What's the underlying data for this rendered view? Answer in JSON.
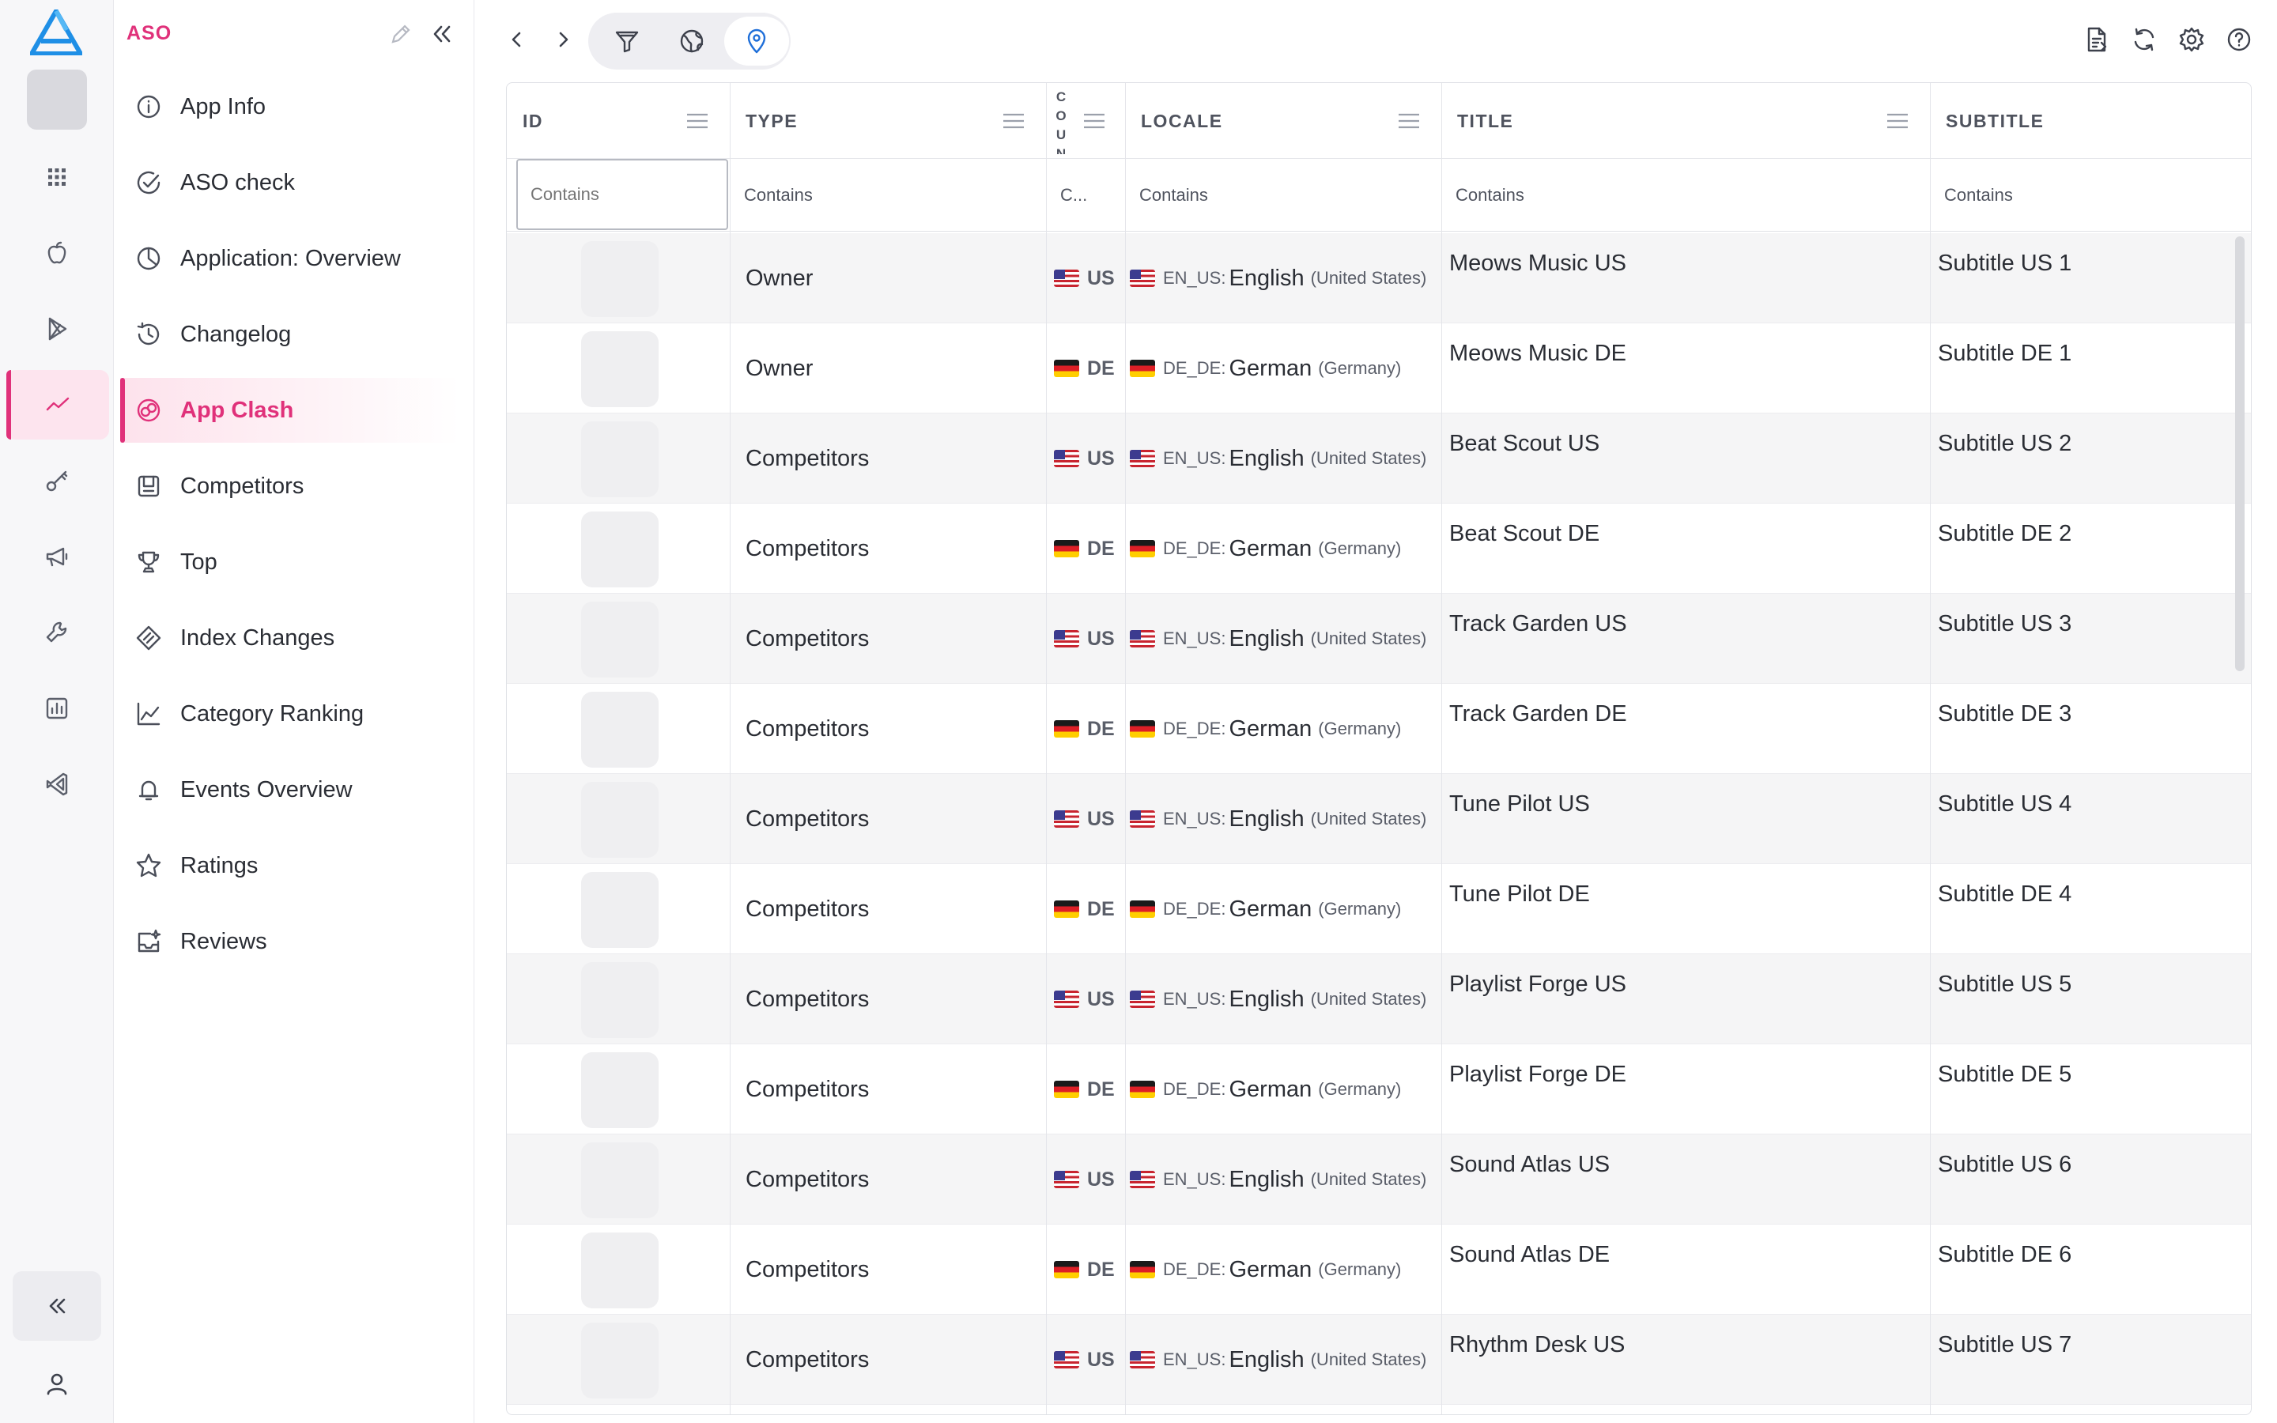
{
  "rail": {
    "items": [
      {
        "name": "apps-grid-icon"
      },
      {
        "name": "apple-icon"
      },
      {
        "name": "google-play-icon"
      },
      {
        "name": "trend-icon",
        "active": true
      },
      {
        "name": "key-icon"
      },
      {
        "name": "megaphone-icon"
      },
      {
        "name": "wrench-icon"
      },
      {
        "name": "bar-chart-icon"
      },
      {
        "name": "visual-studio-icon"
      }
    ]
  },
  "sidebar": {
    "title": "ASO",
    "items": [
      {
        "label": "App Info",
        "icon": "info-icon"
      },
      {
        "label": "ASO check",
        "icon": "check-circle-icon"
      },
      {
        "label": "Application: Overview",
        "icon": "pie-chart-icon"
      },
      {
        "label": "Changelog",
        "icon": "history-icon"
      },
      {
        "label": "App Clash",
        "icon": "app-clash-icon",
        "active": true
      },
      {
        "label": "Competitors",
        "icon": "competitors-icon"
      },
      {
        "label": "Top",
        "icon": "trophy-icon"
      },
      {
        "label": "Index Changes",
        "icon": "index-changes-icon"
      },
      {
        "label": "Category Ranking",
        "icon": "line-chart-icon"
      },
      {
        "label": "Events Overview",
        "icon": "bell-icon"
      },
      {
        "label": "Ratings",
        "icon": "star-icon"
      },
      {
        "label": "Reviews",
        "icon": "reviews-icon"
      }
    ]
  },
  "grid": {
    "columns": {
      "id": "ID",
      "type": "TYPE",
      "country": "COUNTRY",
      "locale": "LOCALE",
      "title": "TITLE",
      "subtitle": "SUBTITLE"
    },
    "filters": {
      "id": "Contains",
      "type": "Contains",
      "country": "C...",
      "locale": "Contains",
      "title": "Contains",
      "subtitle": "Contains"
    },
    "rows": [
      {
        "type": "Owner",
        "flag": "us",
        "country": "US",
        "locale_code": "EN_US:",
        "language": "English",
        "region": "(United States)",
        "title": "Meows Music US",
        "subtitle": "Subtitle US 1"
      },
      {
        "type": "Owner",
        "flag": "de",
        "country": "DE",
        "locale_code": "DE_DE:",
        "language": "German",
        "region": "(Germany)",
        "title": "Meows Music DE",
        "subtitle": "Subtitle DE 1"
      },
      {
        "type": "Competitors",
        "flag": "us",
        "country": "US",
        "locale_code": "EN_US:",
        "language": "English",
        "region": "(United States)",
        "title": "Beat Scout US",
        "subtitle": "Subtitle US 2"
      },
      {
        "type": "Competitors",
        "flag": "de",
        "country": "DE",
        "locale_code": "DE_DE:",
        "language": "German",
        "region": "(Germany)",
        "title": "Beat Scout DE",
        "subtitle": "Subtitle DE 2"
      },
      {
        "type": "Competitors",
        "flag": "us",
        "country": "US",
        "locale_code": "EN_US:",
        "language": "English",
        "region": "(United States)",
        "title": "Track Garden US",
        "subtitle": "Subtitle US 3"
      },
      {
        "type": "Competitors",
        "flag": "de",
        "country": "DE",
        "locale_code": "DE_DE:",
        "language": "German",
        "region": "(Germany)",
        "title": "Track Garden DE",
        "subtitle": "Subtitle DE 3"
      },
      {
        "type": "Competitors",
        "flag": "us",
        "country": "US",
        "locale_code": "EN_US:",
        "language": "English",
        "region": "(United States)",
        "title": "Tune Pilot US",
        "subtitle": "Subtitle US 4"
      },
      {
        "type": "Competitors",
        "flag": "de",
        "country": "DE",
        "locale_code": "DE_DE:",
        "language": "German",
        "region": "(Germany)",
        "title": "Tune Pilot DE",
        "subtitle": "Subtitle DE 4"
      },
      {
        "type": "Competitors",
        "flag": "us",
        "country": "US",
        "locale_code": "EN_US:",
        "language": "English",
        "region": "(United States)",
        "title": "Playlist Forge US",
        "subtitle": "Subtitle US 5"
      },
      {
        "type": "Competitors",
        "flag": "de",
        "country": "DE",
        "locale_code": "DE_DE:",
        "language": "German",
        "region": "(Germany)",
        "title": "Playlist Forge DE",
        "subtitle": "Subtitle DE 5"
      },
      {
        "type": "Competitors",
        "flag": "us",
        "country": "US",
        "locale_code": "EN_US:",
        "language": "English",
        "region": "(United States)",
        "title": "Sound Atlas US",
        "subtitle": "Subtitle US 6"
      },
      {
        "type": "Competitors",
        "flag": "de",
        "country": "DE",
        "locale_code": "DE_DE:",
        "language": "German",
        "region": "(Germany)",
        "title": "Sound Atlas DE",
        "subtitle": "Subtitle DE 6"
      },
      {
        "type": "Competitors",
        "flag": "us",
        "country": "US",
        "locale_code": "EN_US:",
        "language": "English",
        "region": "(United States)",
        "title": "Rhythm Desk US",
        "subtitle": "Subtitle US 7"
      }
    ]
  },
  "colors": {
    "accent": "#e0317a",
    "active_toolbar": "#1f6fd9",
    "logo": "#1f8fe6"
  }
}
